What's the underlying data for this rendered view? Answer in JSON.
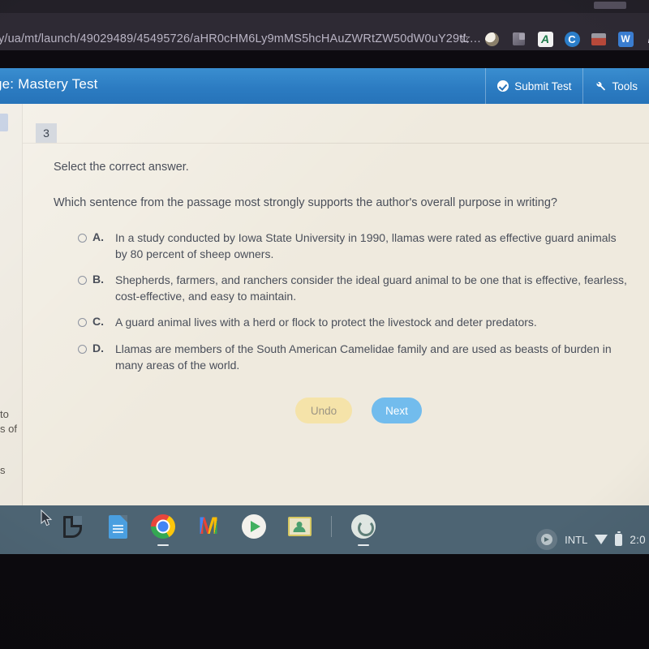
{
  "browser": {
    "url": "y/ua/mt/launch/49029489/45495726/aHR0cHM6Ly9mMS5hcHAuZWRtZW50dW0uY29tL…",
    "bookmark_icon": "star-icon",
    "extensions": [
      {
        "name": "extension-profile-icon",
        "label": ""
      },
      {
        "name": "extension-gray-icon",
        "label": ""
      },
      {
        "name": "extension-achieve-icon",
        "label": "A"
      },
      {
        "name": "extension-c-icon",
        "label": "C"
      },
      {
        "name": "extension-red-icon",
        "label": ""
      },
      {
        "name": "extension-w-icon",
        "label": "W"
      },
      {
        "name": "extension-k-icon",
        "label": "K"
      }
    ]
  },
  "app_header": {
    "title": "ge: Mastery Test",
    "submit_label": "Submit Test",
    "tools_label": "Tools"
  },
  "sidebar": {
    "fragments": [
      "to",
      "s of",
      "s"
    ]
  },
  "question": {
    "number": "3",
    "instruction": "Select the correct answer.",
    "prompt": "Which sentence from the passage most strongly supports the author's overall purpose in writing?",
    "options": [
      {
        "letter": "A.",
        "text": "In a study conducted by Iowa State University in 1990, llamas were rated as effective guard animals by 80 percent of sheep owners.",
        "selected": false
      },
      {
        "letter": "B.",
        "text": "Shepherds, farmers, and ranchers consider the ideal guard animal to be one that is effective, fearless, cost-effective, and easy to maintain.",
        "selected": false
      },
      {
        "letter": "C.",
        "text": "A guard animal lives with a herd or flock to protect the livestock and deter predators.",
        "selected": false
      },
      {
        "letter": "D.",
        "text": "Llamas are members of the South American Camelidae family and are used as beasts of burden in many areas of the world.",
        "selected": false
      }
    ]
  },
  "actions": {
    "undo_label": "Undo",
    "next_label": "Next"
  },
  "shelf": {
    "apps": [
      "launcher-icon",
      "google-docs-icon",
      "chrome-icon",
      "gmail-icon",
      "play-store-icon",
      "google-classroom-icon",
      "screen-capture-icon"
    ],
    "gmail_letter": "M",
    "tray": {
      "keyboard_label": "INTL",
      "wifi_icon": "wifi-icon",
      "battery_icon": "battery-icon",
      "time": "2:0"
    }
  },
  "colors": {
    "header_blue": "#2c7cc2",
    "next_blue": "#72bced",
    "undo_yellow": "#f5e3a9",
    "page_bg": "#efeade",
    "shelf": "#4d6473"
  }
}
